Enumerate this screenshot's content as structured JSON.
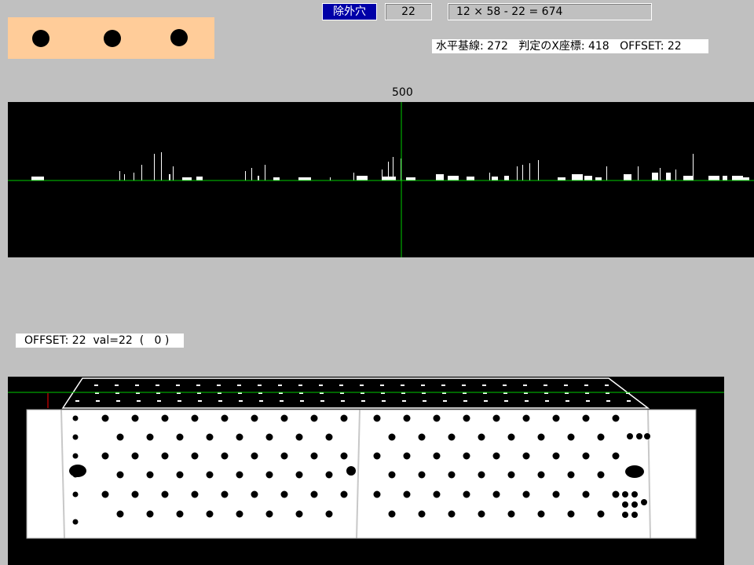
{
  "toolbar": {
    "exclude_hole_label": "除外穴",
    "hole_count": "22",
    "formula": "12 ×  58 -  22 = 674"
  },
  "info": {
    "text": "水平基線: 272   判定のX座標: 418   OFFSET: 22"
  },
  "histogram": {
    "marker_label": "500",
    "baseline_color": "#00cc00",
    "marker_color": "#00cc00",
    "bar_color": "#ffffff"
  },
  "offset_status": {
    "text": "OFFSET: 22  val=22  (   0 )"
  },
  "hole_panel": {
    "color": "#ffcc99",
    "holes": 3
  },
  "plate": {
    "guide_color": "#00cc00",
    "marker_color": "#ff0000"
  }
}
